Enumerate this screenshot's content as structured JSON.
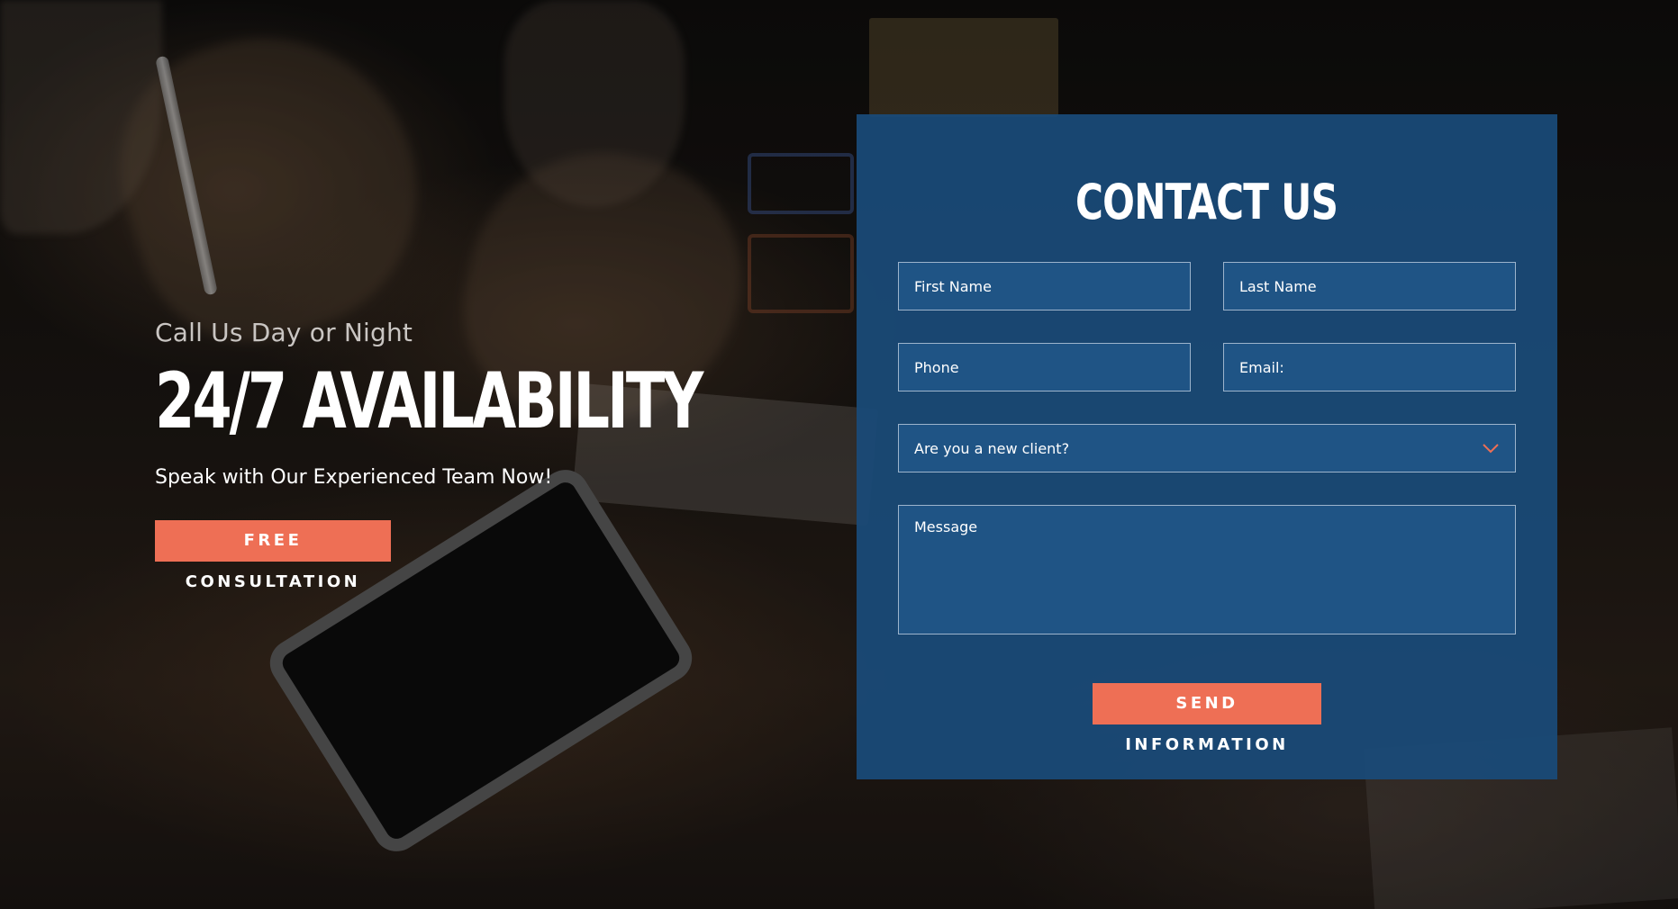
{
  "hero": {
    "eyebrow": "Call Us Day or Night",
    "headline": "24/7 AVAILABILITY",
    "subline": "Speak with Our Experienced Team Now!",
    "cta_label": "FREE CONSULTATION"
  },
  "contact_form": {
    "title": "CONTACT US",
    "first_name_placeholder": "First Name",
    "last_name_placeholder": "Last Name",
    "phone_placeholder": "Phone",
    "email_placeholder": "Email:",
    "client_select_value": "Are you a new client?",
    "client_select_icon": "chevron-down-icon",
    "message_placeholder": "Message",
    "submit_label": "SEND INFORMATION"
  },
  "colors": {
    "accent": "#ee6f55",
    "card_background": "#1a4a78",
    "field_background": "#1f5485",
    "field_border": "#9cb4cc",
    "chevron": "#ee6f55"
  }
}
